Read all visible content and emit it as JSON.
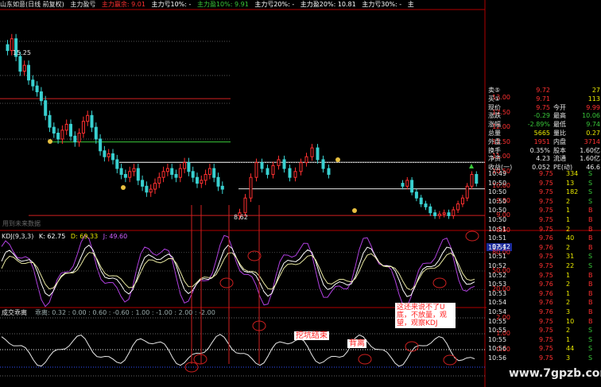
{
  "header": {
    "title": "山东如意(日线 前复权)",
    "items": [
      {
        "label": "主力盈亏",
        "color": "#e8e8e8"
      },
      {
        "label": "主力赢余: 9.01",
        "color": "#ff3030"
      },
      {
        "label": "主力亏10%: -",
        "color": "#ffffff"
      },
      {
        "label": "主力盈10%: 9.91",
        "color": "#39c839"
      },
      {
        "label": "主力亏20%: -",
        "color": "#ffffff"
      },
      {
        "label": "主力盈20%: 10.81",
        "color": "#ffffff"
      },
      {
        "label": "主力亏30%: -",
        "color": "#ffffff"
      },
      {
        "label": "主",
        "color": "#ffffff"
      }
    ]
  },
  "price_panel": {
    "high_label": "15.25",
    "low_label": "8.62",
    "watermark_text": "用到未来数据",
    "y_ticks": [
      "13.00",
      "12.50",
      "12.00",
      "11.50",
      "11.00",
      "10.50",
      "10.00",
      "9.50",
      "9.00",
      "8.50"
    ]
  },
  "kdj_panel": {
    "title": "KDJ(9,3,3)",
    "k": "K: 62.75",
    "d": "D: 69.33",
    "j": "J: 49.60",
    "value_box": "97.42",
    "y_ticks": [
      "80.00",
      "50.00",
      "20.00"
    ]
  },
  "bottom_panel": {
    "title": "成交乖离",
    "subtitle": "乖离: 0.32 : 0.00 : 0.60 : -0.60 : 1.00 : -1.00 : 2.00 : -2.00",
    "y_ticks": [
      "2.00",
      "1.00",
      "0.00"
    ]
  },
  "annotations": {
    "wakeng": "挖坑结束",
    "beili": "背离",
    "note": "这还来说不了U底，不放量，观望，观察KDJ"
  },
  "quote": {
    "rows": [
      {
        "label": "卖⑤",
        "value": "9.72",
        "extra": "27",
        "vcolor": "#ff3030"
      },
      {
        "label": "买①",
        "value": "9.71",
        "extra": "113",
        "vcolor": "#ff3030"
      },
      {
        "label": "现价",
        "value": "9.75",
        "label2": "今开",
        "value2": "9.99",
        "vcolor": "#ff3030"
      },
      {
        "label": "涨跌",
        "value": "-0.29",
        "label2": "最高",
        "value2": "10.06",
        "vcolor": "#39c839"
      },
      {
        "label": "涨幅",
        "value": "-2.89%",
        "label2": "最低",
        "value2": "9.74",
        "vcolor": "#39c839"
      },
      {
        "label": "总量",
        "value": "5665",
        "label2": "量比",
        "value2": "0.27",
        "vcolor": "#e8e800"
      },
      {
        "label": "外盘",
        "value": "1951",
        "label2": "内盘",
        "value2": "3714",
        "vcolor": "#ff3030"
      },
      {
        "label": "换手",
        "value": "0.35%",
        "label2": "股本",
        "value2": "1.60亿",
        "vcolor": "#e8e8e8"
      },
      {
        "label": "净资",
        "value": "4.23",
        "label2": "流通",
        "value2": "1.60亿",
        "vcolor": "#e8e8e8"
      },
      {
        "label": "收益(一)",
        "value": "0.052",
        "label2": "PE(动)",
        "value2": "46.6",
        "vcolor": "#e8e8e8"
      }
    ]
  },
  "ticks": [
    {
      "time": "10:49",
      "price": "9.75",
      "vol": "334",
      "side": "S"
    },
    {
      "time": "10:50",
      "price": "9.75",
      "vol": "13",
      "side": "S"
    },
    {
      "time": "10:50",
      "price": "9.75",
      "vol": "182",
      "side": "S"
    },
    {
      "time": "10:50",
      "price": "9.75",
      "vol": "2",
      "side": "S"
    },
    {
      "time": "10:50",
      "price": "9.75",
      "vol": "1",
      "side": "B"
    },
    {
      "time": "10:50",
      "price": "9.75",
      "vol": "1",
      "side": "B"
    },
    {
      "time": "10:51",
      "price": "9.75",
      "vol": "2",
      "side": "B"
    },
    {
      "time": "10:51",
      "price": "9.76",
      "vol": "40",
      "side": "B"
    },
    {
      "time": "10:51",
      "price": "9.76",
      "vol": "2",
      "side": "B"
    },
    {
      "time": "10:51",
      "price": "9.75",
      "vol": "31",
      "side": "S"
    },
    {
      "time": "10:52",
      "price": "9.75",
      "vol": "22",
      "side": "S"
    },
    {
      "time": "10:52",
      "price": "9.75",
      "vol": "1",
      "side": "B"
    },
    {
      "time": "10:53",
      "price": "9.76",
      "vol": "2",
      "side": "B"
    },
    {
      "time": "10:53",
      "price": "9.76",
      "vol": "1",
      "side": "B"
    },
    {
      "time": "10:54",
      "price": "9.76",
      "vol": "2",
      "side": "B"
    },
    {
      "time": "10:54",
      "price": "9.76",
      "vol": "3",
      "side": "B"
    },
    {
      "time": "10:55",
      "price": "9.75",
      "vol": "10",
      "side": "B"
    },
    {
      "time": "10:55",
      "price": "9.75",
      "vol": "2",
      "side": "S"
    },
    {
      "time": "10:55",
      "price": "9.75",
      "vol": "1",
      "side": "S"
    },
    {
      "time": "10:56",
      "price": "9.75",
      "vol": "44",
      "side": "S"
    },
    {
      "time": "10:56",
      "price": "9.75",
      "vol": "3",
      "side": "S"
    }
  ],
  "site": "www.7gpzb.com",
  "colors": {
    "up": "#ff3030",
    "down": "#39c839",
    "axis": "#b00000",
    "bg": "#000000"
  }
}
